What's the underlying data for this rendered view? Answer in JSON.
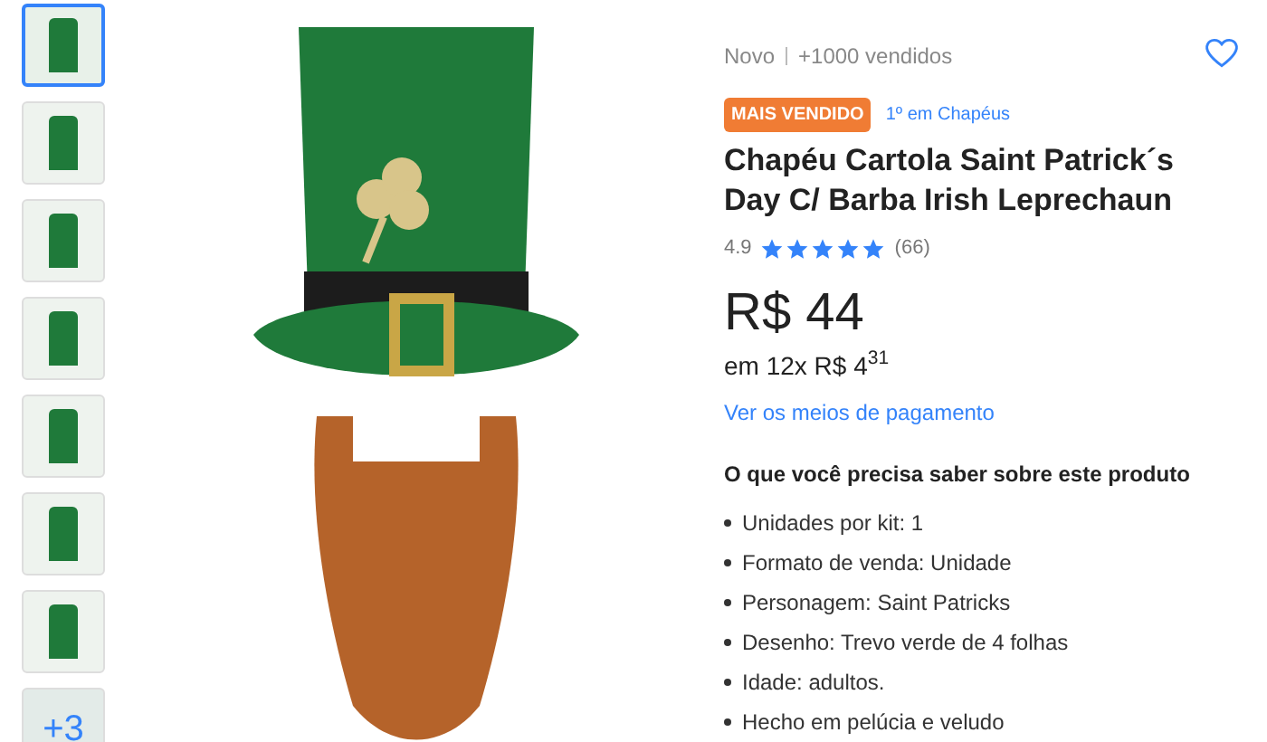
{
  "thumbnails": [
    {
      "selected": true
    },
    {
      "selected": false
    },
    {
      "selected": false
    },
    {
      "selected": false
    },
    {
      "selected": false
    },
    {
      "selected": false
    },
    {
      "selected": false
    }
  ],
  "more_photos": {
    "label": "+3"
  },
  "product": {
    "condition": "Novo",
    "sold": "+1000 vendidos",
    "favorite": false,
    "badge": "MAIS VENDIDO",
    "ranking": "1º em Chapéus",
    "title": "Chapéu Cartola Saint Patrick´s Day C/ Barba Irish Leprechaun",
    "rating": "4.9",
    "stars": 5,
    "reviews": "(66)",
    "price": "R$ 44",
    "installments": "em 12x R$ 4$^{31}$",
    "payment_link": "Ver os meios de pagamento"
  },
  "features": {
    "heading": "O que você precisa saber sobre este produto",
    "items": [
      "Unidades por kit: 1",
      "Formato de venda: Unidade",
      "Personagem: Saint Patricks",
      "Desenho: Trevo verde de 4 folhas",
      "Idade: adultos.",
      "Hecho em pelúcia e veludo"
    ]
  }
}
